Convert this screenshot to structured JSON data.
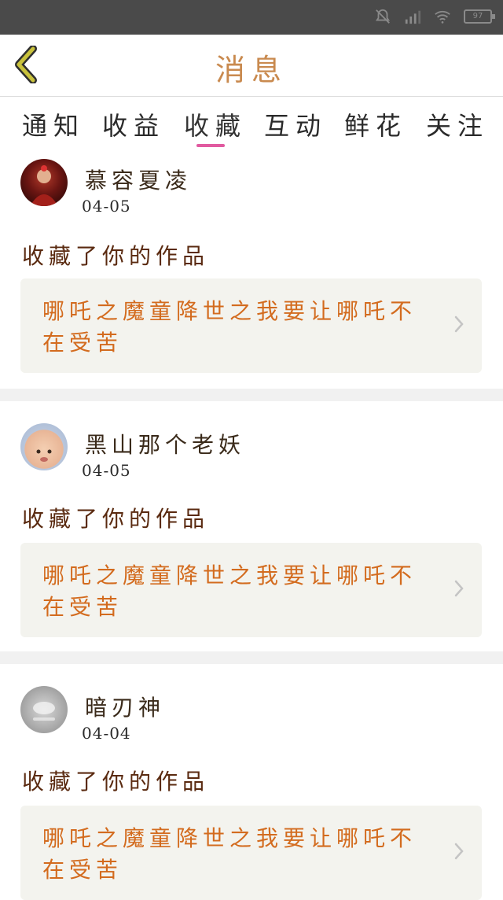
{
  "status_bar": {
    "battery": "97"
  },
  "header": {
    "title": "消息"
  },
  "tabs": [
    {
      "label": "通知"
    },
    {
      "label": "收益"
    },
    {
      "label": "收藏"
    },
    {
      "label": "互动"
    },
    {
      "label": "鲜花"
    },
    {
      "label": "关注"
    }
  ],
  "active_tab": "收藏",
  "messages": [
    {
      "user": "慕容夏凌",
      "date": "04-05",
      "action": "收藏了你的作品",
      "work_title": "哪吒之魔童降世之我要让哪吒不在受苦"
    },
    {
      "user": "黑山那个老妖",
      "date": "04-05",
      "action": "收藏了你的作品",
      "work_title": "哪吒之魔童降世之我要让哪吒不在受苦"
    },
    {
      "user": "暗刃神",
      "date": "04-04",
      "action": "收藏了你的作品",
      "work_title": "哪吒之魔童降世之我要让哪吒不在受苦"
    }
  ],
  "colors": {
    "accent": "#e15aa0",
    "back_icon": "#c9c23c",
    "work_box_bg": "#f3f3ee"
  }
}
